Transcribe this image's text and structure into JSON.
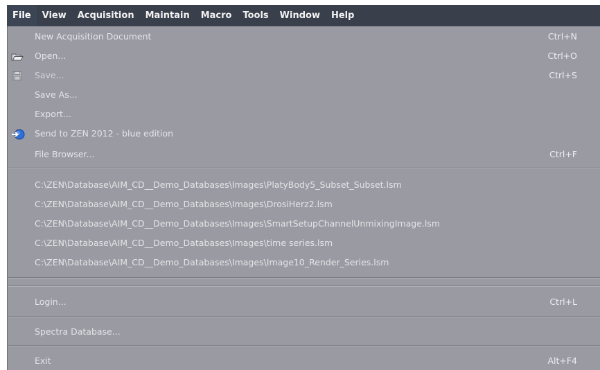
{
  "menubar": {
    "items": [
      "File",
      "View",
      "Acquisition",
      "Maintain",
      "Macro",
      "Tools",
      "Window",
      "Help"
    ]
  },
  "file_menu": {
    "items": [
      {
        "label": "New Acquisition Document",
        "shortcut": "Ctrl+N",
        "icon": ""
      },
      {
        "label": "Open...",
        "shortcut": "Ctrl+O",
        "icon": "folder-icon"
      },
      {
        "label": "Save...",
        "shortcut": "Ctrl+S",
        "icon": "save-icon"
      },
      {
        "label": "Save As...",
        "shortcut": "",
        "icon": ""
      },
      {
        "label": "Export...",
        "shortcut": "",
        "icon": ""
      },
      {
        "label": "Send to ZEN 2012 - blue edition",
        "shortcut": "",
        "icon": "send-icon"
      },
      {
        "label": "File Browser...",
        "shortcut": "Ctrl+F",
        "icon": ""
      }
    ],
    "recent_files": [
      "C:\\ZEN\\Database\\AIM_CD__Demo_Databases\\Images\\PlatyBody5_Subset_Subset.lsm",
      "C:\\ZEN\\Database\\AIM_CD__Demo_Databases\\Images\\DrosiHerz2.lsm",
      "C:\\ZEN\\Database\\AIM_CD__Demo_Databases\\Images\\SmartSetupChannelUnmixingImage.lsm",
      "C:\\ZEN\\Database\\AIM_CD__Demo_Databases\\Images\\time series.lsm",
      "C:\\ZEN\\Database\\AIM_CD__Demo_Databases\\Images\\Image10_Render_Series.lsm"
    ],
    "login": {
      "label": "Login...",
      "shortcut": "Ctrl+L"
    },
    "spectra": {
      "label": "Spectra Database..."
    },
    "exit": {
      "label": "Exit",
      "shortcut": "Alt+F4"
    }
  },
  "colors": {
    "menubar_bg": "#3a3f4c",
    "menu_bg": "#9a9aa2",
    "text": "#e4e4e8",
    "send_icon_blue": "#2f6fd6"
  }
}
